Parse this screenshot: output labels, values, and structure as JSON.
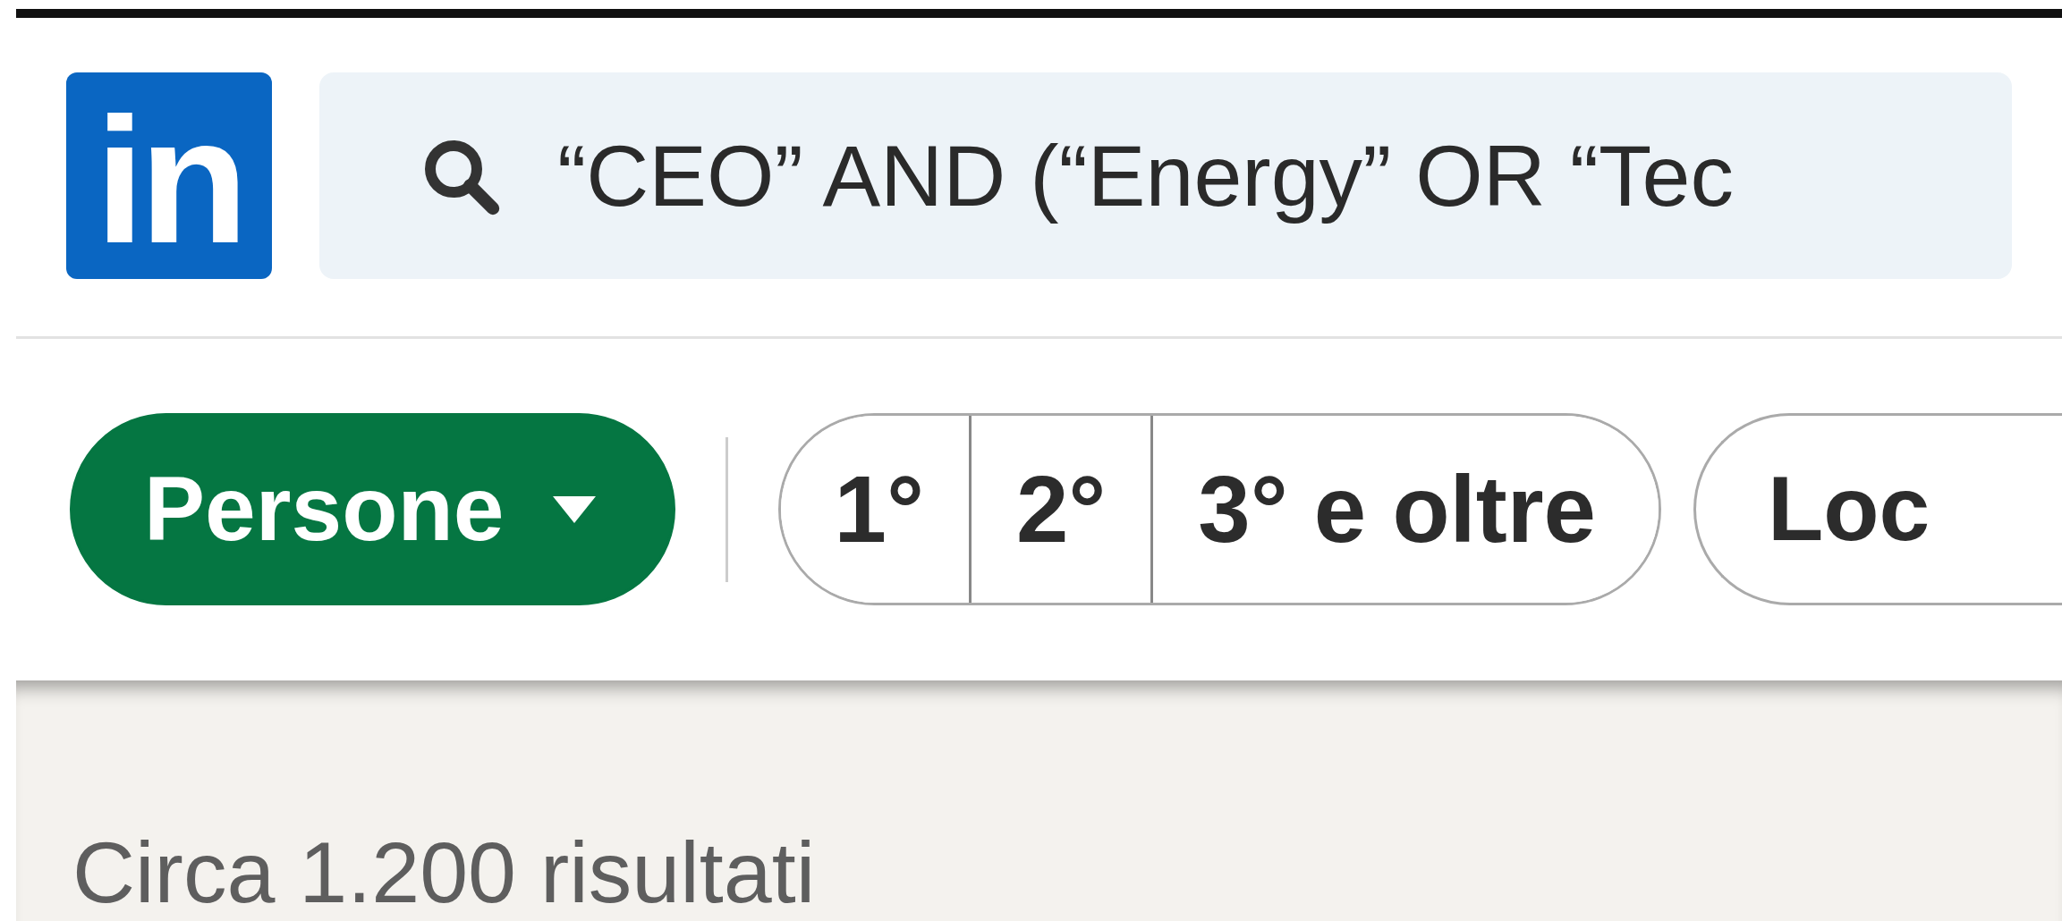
{
  "logo": {
    "text": "in"
  },
  "search": {
    "value": "“CEO” AND (“Energy” OR “Tec"
  },
  "type_filter": {
    "label": "Persone",
    "selected": true
  },
  "connection_filters": [
    {
      "label": "1°",
      "selected": false
    },
    {
      "label": "2°",
      "selected": false
    },
    {
      "label": "3° e oltre",
      "selected": false
    }
  ],
  "more_filters": [
    {
      "label": "Loc",
      "selected": false
    }
  ],
  "results_count": "Circa 1.200 risultati"
}
